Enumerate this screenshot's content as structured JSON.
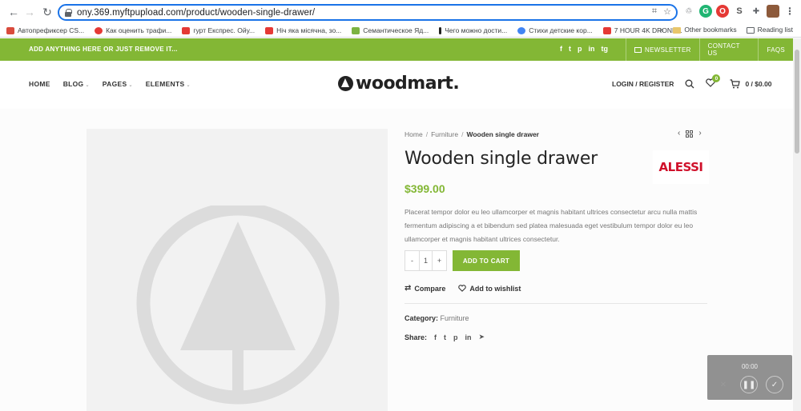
{
  "browser": {
    "url": "ony.369.myftpupload.com/product/wooden-single-drawer/",
    "bookmarks": [
      {
        "label": "Автопрефиксер CS...",
        "color": "#d94b3d"
      },
      {
        "label": "Как оценить трафи...",
        "color": "#e53935"
      },
      {
        "label": "гурт Експрес. Ойу...",
        "color": "#e53935"
      },
      {
        "label": "Ніч яка місячна, зо...",
        "color": "#e53935"
      },
      {
        "label": "Семантическое Яд...",
        "color": "#7cb342"
      },
      {
        "label": "Чего можно дости...",
        "color": "#222222"
      },
      {
        "label": "Стихи детские кор...",
        "color": "#4285f4"
      },
      {
        "label": "7 HOUR 4K DRONE...",
        "color": "#e53935"
      }
    ],
    "bookmarks_more": "»",
    "other_bookmarks": "Other bookmarks",
    "reading_list": "Reading list"
  },
  "topbar": {
    "text": "ADD ANYTHING HERE OR JUST REMOVE IT...",
    "social": [
      "f",
      "t",
      "p",
      "in",
      "tg"
    ],
    "newsletter": "NEWSLETTER",
    "contact": "CONTACT US",
    "faqs": "FAQS"
  },
  "header": {
    "nav": [
      "HOME",
      "BLOG",
      "PAGES",
      "ELEMENTS"
    ],
    "logo": "woodmart.",
    "login": "LOGIN / REGISTER",
    "wishlist_count": "0",
    "cart": "0 / $0.00"
  },
  "product": {
    "breadcrumb": [
      "Home",
      "Furniture",
      "Wooden single drawer"
    ],
    "title": "Wooden single drawer",
    "brand": "ALESSI",
    "price": "$399.00",
    "description": "Placerat tempor dolor eu leo ullamcorper et magnis habitant ultrices consectetur arcu nulla mattis fermentum adipiscing a et bibendum sed platea malesuada eget vestibulum tempor dolor eu leo ullamcorper et magnis habitant ultrices consectetur.",
    "qty_minus": "-",
    "qty_value": "1",
    "qty_plus": "+",
    "add_to_cart": "ADD TO CART",
    "compare": "Compare",
    "wishlist": "Add to wishlist",
    "category_label": "Category:",
    "category_value": "Furniture",
    "share_label": "Share:"
  },
  "recorder": {
    "time": "00:00"
  },
  "colors": {
    "accent": "#83b735",
    "brand_red": "#d0112b",
    "omnibox_focus": "#1a73e8"
  }
}
